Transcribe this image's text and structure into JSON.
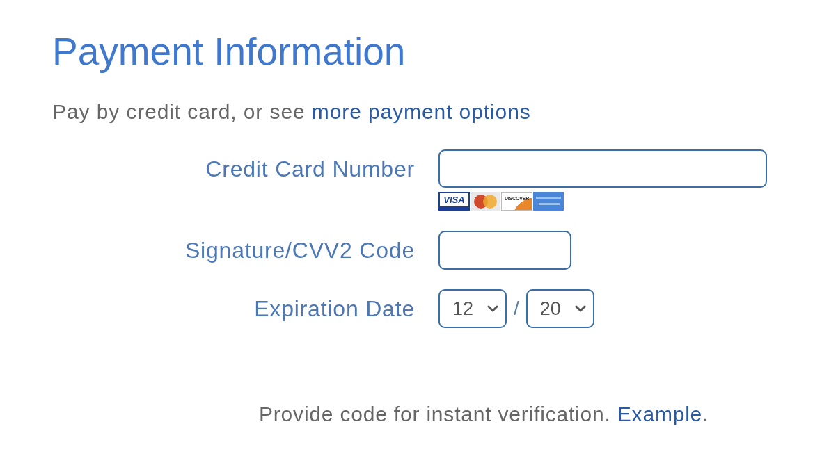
{
  "title": "Payment Information",
  "intro": {
    "text": "Pay by credit card, or see",
    "link": "more payment options"
  },
  "fields": [
    {
      "kind": "card_number",
      "label": "Credit Card Number",
      "card_logos": [
        {
          "kind": "visa",
          "text": "VISA"
        },
        {
          "kind": "mastercard"
        },
        {
          "kind": "discover",
          "text": "DISCOVER"
        },
        {
          "kind": "amex"
        }
      ]
    },
    {
      "kind": "cvv",
      "label": "Signature/CVV2 Code"
    },
    {
      "kind": "expiration",
      "label": "Expiration Date",
      "month": "12",
      "separator": "/",
      "year": "20"
    }
  ],
  "footer": {
    "text": "Provide code for instant verification.",
    "link": "Example",
    "end": "."
  }
}
